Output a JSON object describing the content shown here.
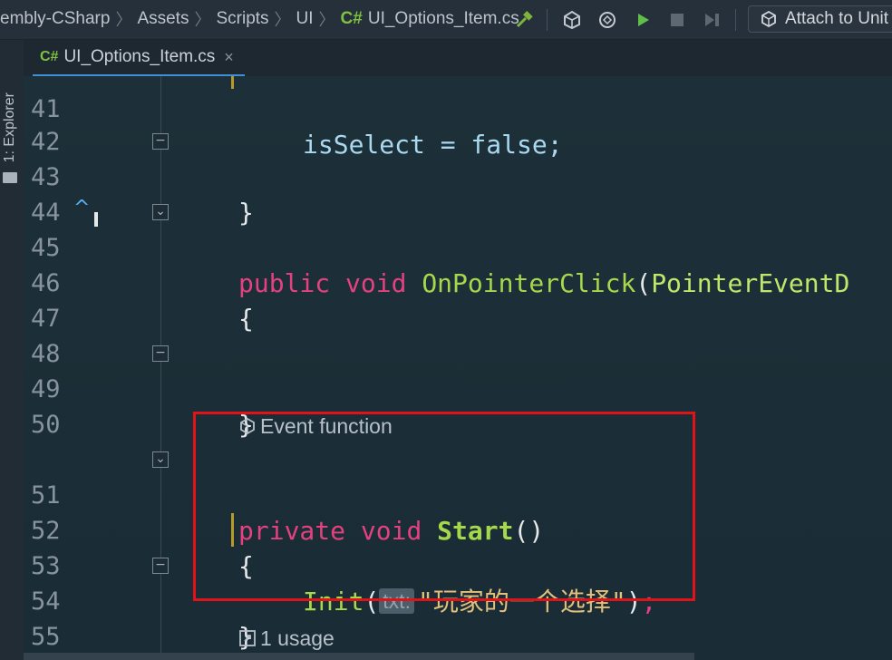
{
  "breadcrumb": {
    "items": [
      "embly-CSharp",
      "Assets",
      "Scripts",
      "UI"
    ],
    "file_lang_tag": "C#",
    "file_name": "UI_Options_Item.cs"
  },
  "toolbar": {
    "build_icon": "hammer-icon",
    "unity_icon": "unity-icon",
    "refresh_icon": "unity-refresh-icon",
    "play_icon": "play-icon",
    "stop_icon": "stop-icon",
    "step_icon": "step-icon",
    "attach_label": "Attach to Unit"
  },
  "side_panel": {
    "explorer_label": "1: Explorer"
  },
  "tab": {
    "lang_tag": "C#",
    "file_name": "UI_Options_Item.cs",
    "close_glyph": "×"
  },
  "editor": {
    "partial_top_line": {
      "number": "41",
      "code": "isSelect = false;"
    },
    "lines": [
      {
        "number": "42",
        "code": ""
      },
      {
        "number": "43",
        "code": "}"
      },
      {
        "number": "44",
        "code": ""
      },
      {
        "number": "45",
        "kw1": "public",
        "kw2": "void",
        "name": "OnPointerClick",
        "paren": "(",
        "type": "PointerEventD"
      },
      {
        "number": "46",
        "code": "{"
      },
      {
        "number": "47",
        "code": ""
      },
      {
        "number": "48",
        "code": ""
      },
      {
        "number": "49",
        "code": "}"
      },
      {
        "number": "50",
        "code": ""
      },
      {
        "number": "51",
        "kw1": "private",
        "kw2": "void",
        "name": "Start",
        "paren": "()"
      },
      {
        "number": "52",
        "code": "{"
      },
      {
        "number": "53",
        "name": "Init",
        "open": "(",
        "param_hint": "txt:",
        "string": "\"玩家的一个选择\"",
        "close": ")",
        "semi": ";"
      },
      {
        "number": "54",
        "code": "}"
      },
      {
        "number": "55",
        "code": ""
      }
    ],
    "event_function_hint": "Event function",
    "usage_hint": "1 usage"
  },
  "colors": {
    "keyword": "#e3417f",
    "method": "#a6d84c",
    "string": "#e2c07c",
    "highlight_box": "#e01318"
  }
}
